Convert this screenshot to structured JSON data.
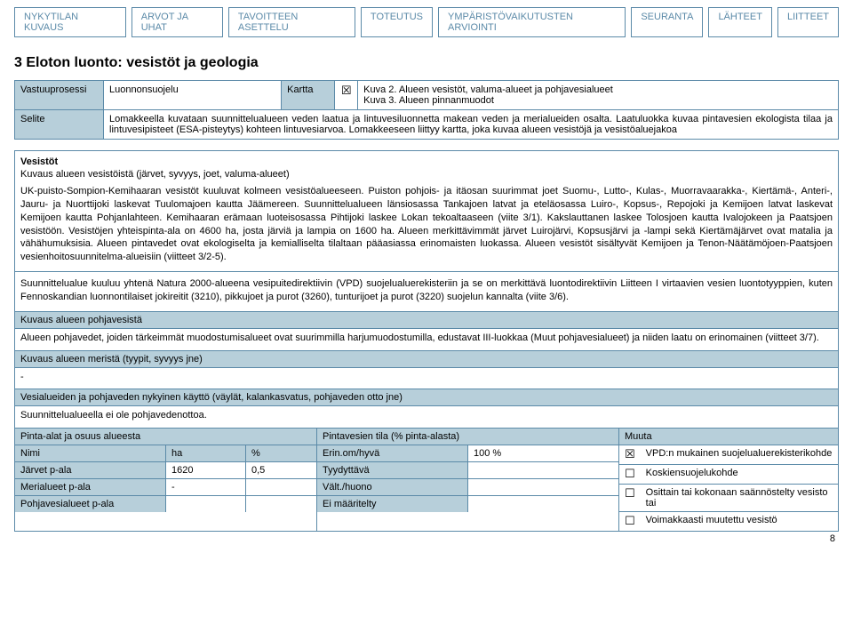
{
  "tabs": [
    "NYKYTILAN KUVAUS",
    "ARVOT JA UHAT",
    "TAVOITTEEN ASETTELU",
    "TOTEUTUS",
    "YMPÄRISTÖVAIKUTUSTEN ARVIOINTI",
    "SEURANTA",
    "LÄHTEET",
    "LIITTEET"
  ],
  "section_title": "3 Eloton luonto: vesistöt ja geologia",
  "info": {
    "vastuuprosessi_label": "Vastuuprosessi",
    "vastuuprosessi_value": "Luonnonsuojelu",
    "kartta_label": "Kartta",
    "kartta_check": "☒",
    "maps": "Kuva 2. Alueen vesistöt, valuma-alueet ja pohjavesialueet\nKuva 3. Alueen pinnanmuodot",
    "selite_label": "Selite",
    "selite_text": "Lomakkeella kuvataan suunnittelualueen veden laatua ja lintuvesiluonnetta makean veden ja merialueiden osalta. Laatuluokka kuvaa pintavesien ekologista tilaa ja lintuvesipisteet (ESA-pisteytys) kohteen lintuvesiarvoa. Lomakkeeseen liittyy kartta, joka kuvaa alueen vesistöjä ja vesistöaluejakoa"
  },
  "vesistot": {
    "heading": "Vesistöt",
    "sub": "Kuvaus alueen vesistöistä (järvet, syvyys, joet, valuma-alueet)",
    "para": "UK-puisto-Sompion-Kemihaaran vesistöt kuuluvat kolmeen vesistöalueeseen. Puiston pohjois- ja itäosan suurimmat joet Suomu-, Lutto-, Kulas-, Muorravaarakka-, Kiertämä-, Anteri-, Jauru- ja Nuorttijoki laskevat Tuulomajoen kautta Jäämereen. Suunnittelualueen länsiosassa Tankajoen latvat ja eteläosassa Luiro-, Kopsus-, Repojoki ja Kemijoen latvat laskevat Kemijoen kautta Pohjanlahteen. Kemihaaran erämaan luoteisosassa Pihtijoki laskee Lokan tekoaltaaseen (viite 3/1). Kakslauttanen laskee Tolosjoen kautta Ivalojokeen ja Paatsjoen vesistöön. Vesistöjen yhteispinta-ala on 4600 ha, josta järviä ja lampia on 1600 ha. Alueen merkittävimmät järvet Luirojärvi, Kopsusjärvi ja -lampi sekä Kiertämäjärvet ovat matalia ja vähähumuksisia. Alueen pintavedet ovat ekologiselta ja kemialliselta tilaltaan pääasiassa erinomaisten luokassa. Alueen vesistöt sisältyvät Kemijoen ja Tenon-Näätämöjoen-Paatsjoen vesienhoitosuunnitelma-alueisiin (viitteet 3/2-5).",
    "para2": "Suunnittelualue kuuluu yhtenä Natura 2000-alueena vesipuitedirektiivin (VPD) suojelualuerekisteriin ja se on merkittävä luontodirektiivin Liitteen I virtaavien vesien luontotyyppien, kuten Fennoskandian luonnontilaiset jokireitit (3210), pikkujoet ja purot (3260), tunturijoet ja purot (3220) suojelun kannalta (viite 3/6).",
    "pohjavesi_heading": "Kuvaus alueen pohjavesistä",
    "pohjavesi_text": "Alueen pohjavedet, joiden tärkeimmät muodostumisalueet ovat suurimmilla harjumuodostumilla, edustavat III-luokkaa (Muut pohjavesialueet) ja niiden laatu on erinomainen (viitteet 3/7).",
    "merista_heading": "Kuvaus alueen meristä (tyypit, syvyys jne)",
    "merista_text": "-",
    "kaytto_heading": "Vesialueiden ja pohjaveden nykyinen käyttö (väylät, kalankasvatus, pohjaveden otto jne)",
    "kaytto_text": "Suunnittelualueella ei ole pohjavedenottoa."
  },
  "table": {
    "colA": {
      "title": "Pinta-alat ja osuus alueesta",
      "h1": "Nimi",
      "h2": "ha",
      "h3": "%",
      "rows": [
        {
          "c1": "Järvet p-ala",
          "c2": "1620",
          "c3": "0,5"
        },
        {
          "c1": "Merialueet p-ala",
          "c2": "-",
          "c3": ""
        },
        {
          "c1": "Pohjavesialueet p-ala",
          "c2": "",
          "c3": ""
        }
      ]
    },
    "colB": {
      "title": "Pintavesien tila (% pinta-alasta)",
      "rows": [
        {
          "c1": "Erin.om/hyvä",
          "c2": "100 %"
        },
        {
          "c1": "Tyydyttävä",
          "c2": ""
        },
        {
          "c1": "Vält./huono",
          "c2": ""
        },
        {
          "c1": "Ei määritelty",
          "c2": ""
        }
      ]
    },
    "colC": {
      "title": "Muuta",
      "rows": [
        {
          "chk": "☒",
          "text": "VPD:n mukainen suojelualuerekisterikohde"
        },
        {
          "chk": "☐",
          "text": "Koskiensuojelukohde"
        },
        {
          "chk": "☐",
          "text": "Osittain tai kokonaan saännöstelty vesisto tai"
        },
        {
          "chk": "☐",
          "text": "Voimakkaasti muutettu vesistö"
        }
      ]
    }
  },
  "page_number": "8"
}
